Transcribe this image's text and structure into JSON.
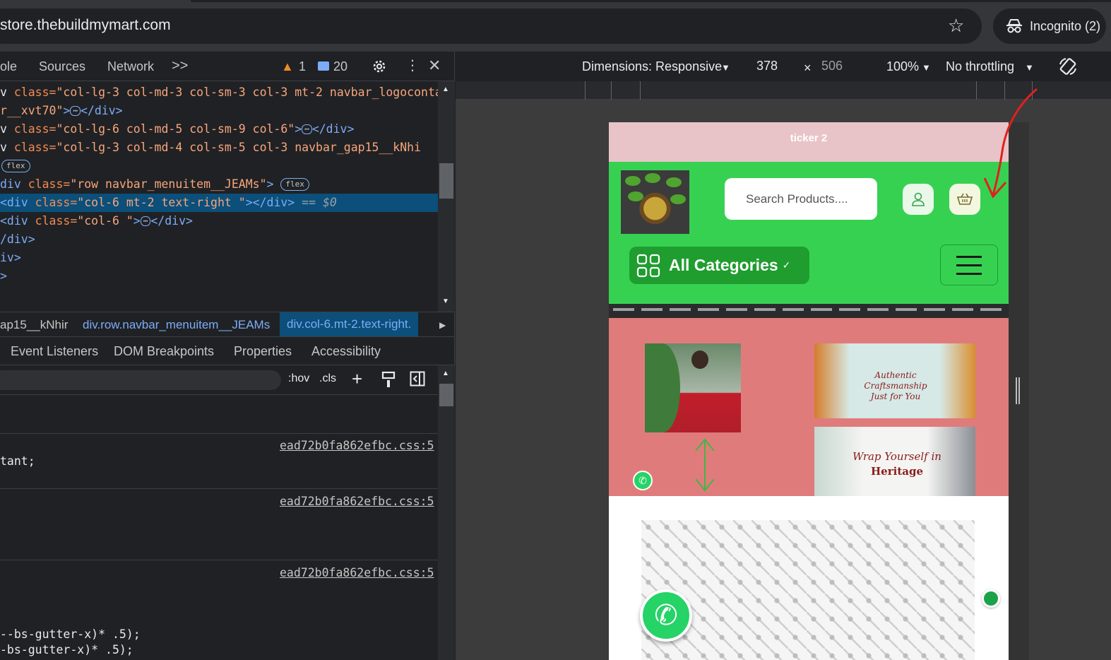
{
  "browser": {
    "url": "store.thebuildmymart.com",
    "incognito_label": "Incognito (2)"
  },
  "devtools": {
    "tabs": [
      "ole",
      "Sources",
      "Network"
    ],
    "more_tabs": ">>",
    "warning_count": "1",
    "message_count": "20",
    "tree_lines": [
      {
        "pre": "v ",
        "attr": "class=",
        "val": "\"col-lg-3 col-md-3 col-sm-3 col-3 mt-2 navbar_logoconta"
      },
      {
        "pre": "",
        "val": "r__xvt70\"",
        "tag": ">",
        "dots": "⋯",
        "close": "</div>"
      },
      {
        "pre": "v ",
        "attr": "class=",
        "val": "\"col-lg-6 col-md-5 col-sm-9 col-6\"",
        "tag": ">",
        "dots": "⋯",
        "close": "</div>"
      },
      {
        "pre": "v ",
        "attr": "class=",
        "val": "\"col-lg-3 col-md-4 col-sm-5 col-3  navbar_gap15__kNhi"
      },
      {
        "pill": "flex"
      },
      {
        "pre": "div ",
        "attr": "class=",
        "val": "\"row navbar_menuitem__JEAMs\"",
        "tag": ">",
        "pill": "flex"
      },
      {
        "pre": "<div ",
        "attr": "class=",
        "val": "\"col-6 mt-2 text-right \"",
        "tag": "></div>",
        "eq": " == $0"
      },
      {
        "pre": "<div ",
        "attr": "class=",
        "val": "\"col-6 \"",
        "tag": ">",
        "dots": "⋯",
        "close": "</div>"
      },
      {
        "close": "/div>"
      },
      {
        "close": "iv>"
      },
      {
        "close": ">"
      }
    ],
    "breadcrumbs": [
      "ap15__kNhir",
      "div.row.navbar_menuitem__JEAMs",
      "div.col-6.mt-2.text-right."
    ],
    "styles_tabs": [
      "Event Listeners",
      "DOM Breakpoints",
      "Properties",
      "Accessibility"
    ],
    "filter_buttons": [
      ":hov",
      ".cls"
    ],
    "css_source": "ead72b0fa862efbc.css:5",
    "css_lines": [
      "tant;",
      "--bs-gutter-x)* .5);",
      "-bs-gutter-x)* .5);"
    ]
  },
  "device_toolbar": {
    "dimensions": "Dimensions: Responsive",
    "width": "378",
    "height": "506",
    "times": "×",
    "zoom": "100%",
    "throttle": "No throttling"
  },
  "site": {
    "ticker": "ticker 2",
    "search_placeholder": "Search Products....",
    "all_categories": "All Categories",
    "caption1_line1": "Authentic Craftsmanship",
    "caption1_line2": "Just for You",
    "caption2_line1": "Wrap Yourself in",
    "caption2_line2": "Heritage"
  },
  "colors": {
    "navbar_green": "#37d152",
    "banner_pink": "#e07b7c",
    "ticker_pink": "#e8c4c8",
    "selection_blue": "#0b4f7a",
    "annotation_red": "#e0201e"
  }
}
